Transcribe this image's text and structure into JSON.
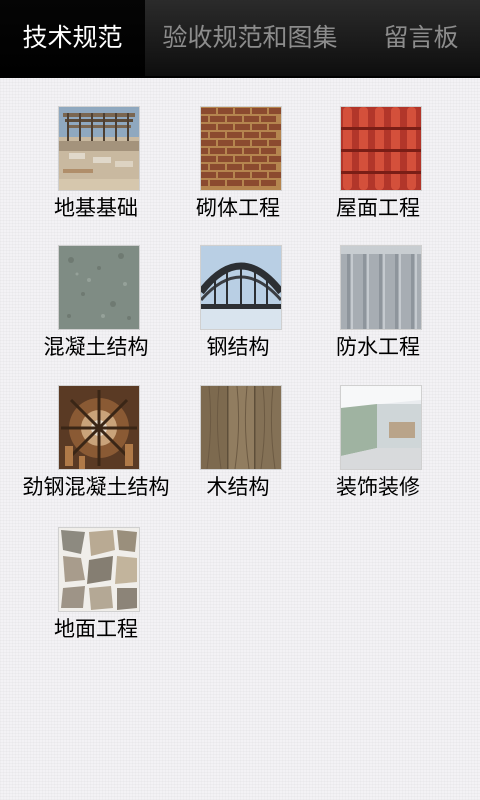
{
  "tabs": [
    {
      "label": "技术规范",
      "active": true
    },
    {
      "label": "验收规范和图集",
      "active": false
    },
    {
      "label": "留言板",
      "active": false
    }
  ],
  "grid": [
    {
      "label": "地基基础",
      "icon": "foundation-construction-image"
    },
    {
      "label": "砌体工程",
      "icon": "brick-wall-image"
    },
    {
      "label": "屋面工程",
      "icon": "roof-tiles-image"
    },
    {
      "label": "混凝土结构",
      "icon": "concrete-surface-image"
    },
    {
      "label": "钢结构",
      "icon": "steel-bridge-image"
    },
    {
      "label": "防水工程",
      "icon": "waterproof-roof-image"
    },
    {
      "label": "劲钢混凝土结构",
      "icon": "steel-reinforcement-image"
    },
    {
      "label": "木结构",
      "icon": "wood-planks-image"
    },
    {
      "label": "装饰装修",
      "icon": "interior-decoration-image"
    },
    {
      "label": "地面工程",
      "icon": "stone-floor-image"
    }
  ]
}
